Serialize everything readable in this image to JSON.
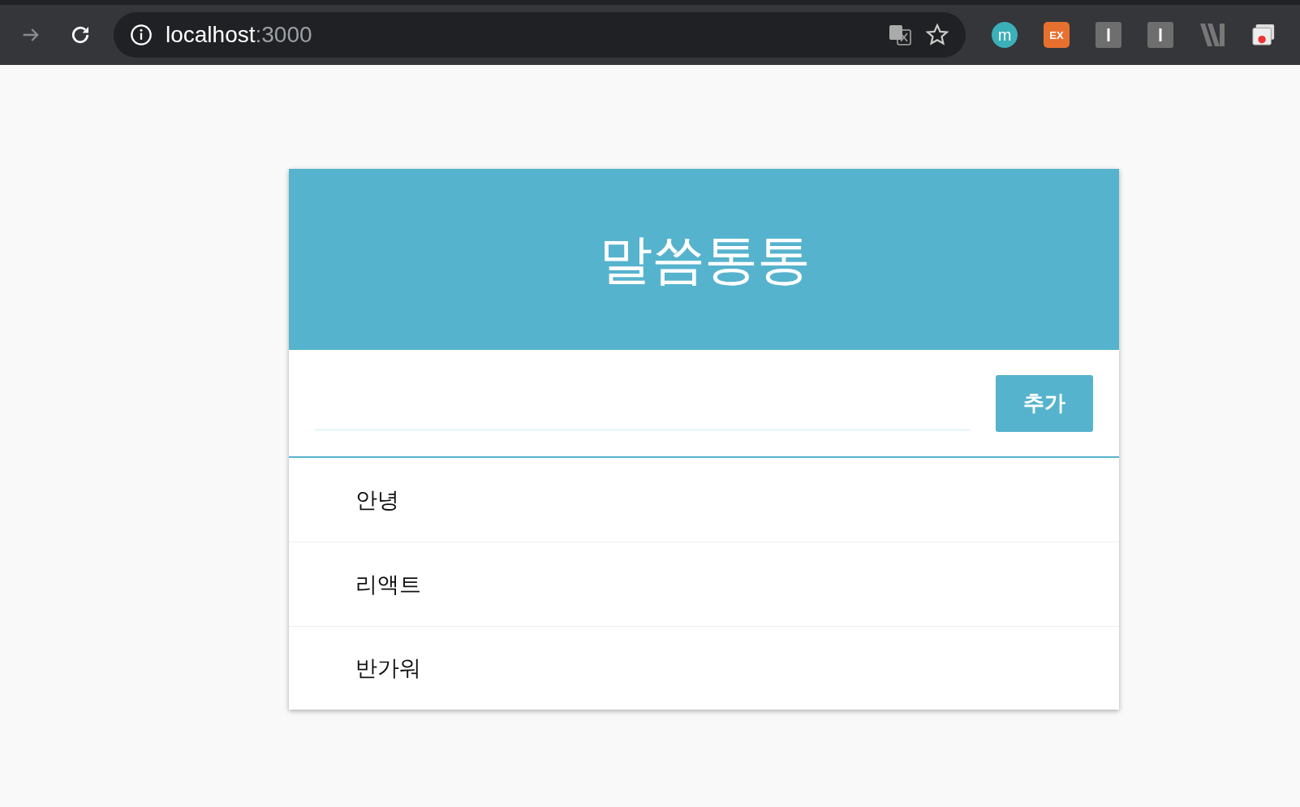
{
  "browser": {
    "address_host": "localhost",
    "address_port": ":3000",
    "extensions": [
      {
        "label": "m",
        "kind": "round",
        "color": "#3bb0b8"
      },
      {
        "label": "EX",
        "kind": "square",
        "color": "#e8702f"
      }
    ]
  },
  "app": {
    "title": "말씀통통",
    "add_button": "추가",
    "items": [
      {
        "text": "안녕"
      },
      {
        "text": "리액트"
      },
      {
        "text": "반가워"
      }
    ]
  }
}
